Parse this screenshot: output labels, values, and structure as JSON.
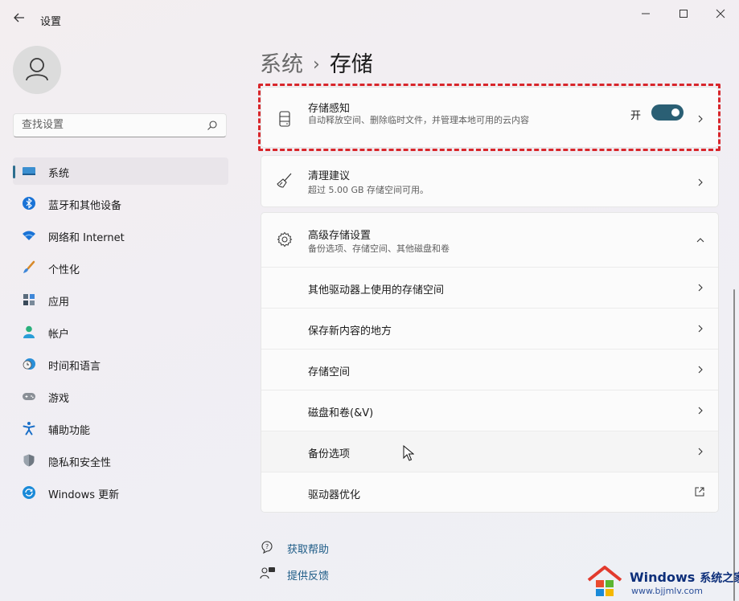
{
  "window": {
    "title": "设置"
  },
  "sidebar": {
    "search_placeholder": "查找设置",
    "items": [
      {
        "label": "系统",
        "icon": "system-icon"
      },
      {
        "label": "蓝牙和其他设备",
        "icon": "bluetooth-icon"
      },
      {
        "label": "网络和 Internet",
        "icon": "wifi-icon"
      },
      {
        "label": "个性化",
        "icon": "brush-icon"
      },
      {
        "label": "应用",
        "icon": "apps-icon"
      },
      {
        "label": "帐户",
        "icon": "account-icon"
      },
      {
        "label": "时间和语言",
        "icon": "clock-globe-icon"
      },
      {
        "label": "游戏",
        "icon": "gamepad-icon"
      },
      {
        "label": "辅助功能",
        "icon": "accessibility-icon"
      },
      {
        "label": "隐私和安全性",
        "icon": "shield-icon"
      },
      {
        "label": "Windows 更新",
        "icon": "update-icon"
      }
    ]
  },
  "breadcrumb": {
    "parent": "系统",
    "current": "存储"
  },
  "storage_sense": {
    "title": "存储感知",
    "description": "自动释放空间、删除临时文件，并管理本地可用的云内容",
    "toggle_label": "开",
    "toggle_on": true,
    "toggle_color": "#2a5f74"
  },
  "cleanup": {
    "title": "清理建议",
    "description": "超过 5.00 GB 存储空间可用。"
  },
  "advanced": {
    "title": "高级存储设置",
    "description": "备份选项、存储空间、其他磁盘和卷",
    "items": [
      {
        "label": "其他驱动器上使用的存储空间"
      },
      {
        "label": "保存新内容的地方"
      },
      {
        "label": "存储空间"
      },
      {
        "label": "磁盘和卷(&V)"
      },
      {
        "label": "备份选项"
      },
      {
        "label": "驱动器优化"
      }
    ]
  },
  "footer": {
    "help": "获取帮助",
    "feedback": "提供反馈"
  },
  "watermark": {
    "brand": "Windows",
    "brand_cn": "系统之家",
    "url": "www.bjjmlv.com"
  },
  "accent_color": "#2e6f8f",
  "highlight_color": "#d8262b"
}
